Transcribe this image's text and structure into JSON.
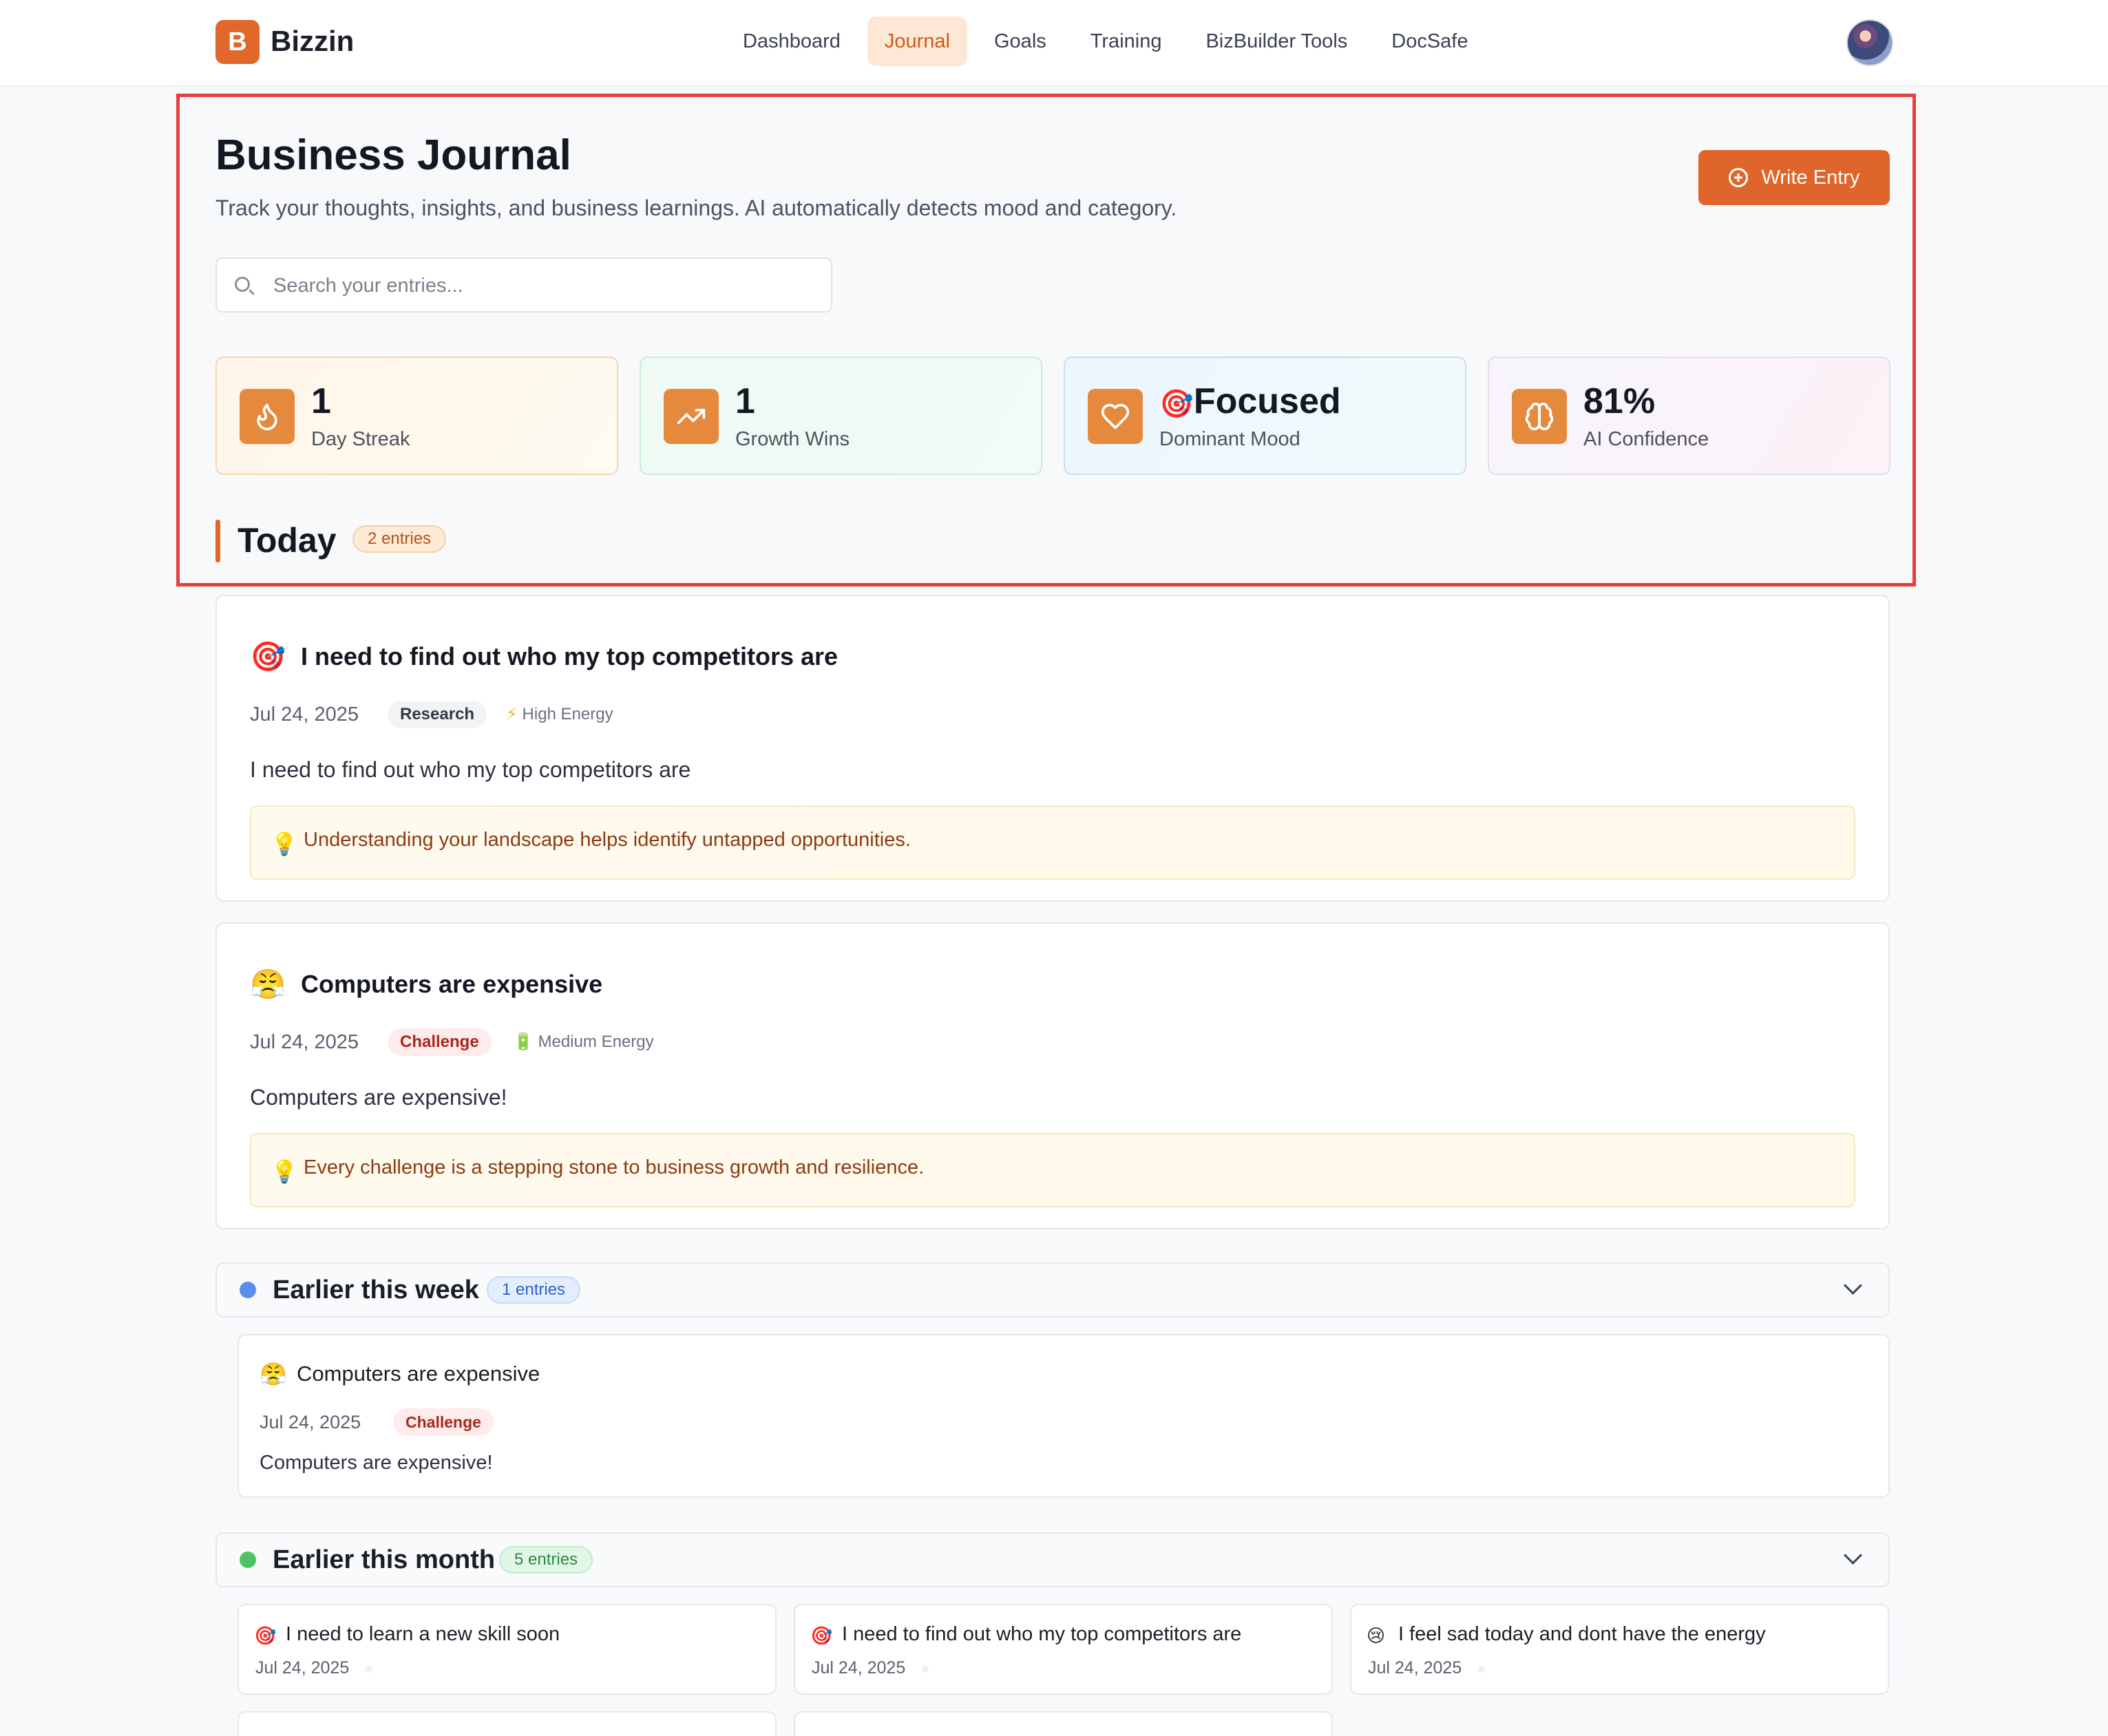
{
  "app": {
    "logo_letter": "B",
    "name": "Bizzin"
  },
  "nav": {
    "items": [
      {
        "label": "Dashboard",
        "active": false
      },
      {
        "label": "Journal",
        "active": true
      },
      {
        "label": "Goals",
        "active": false
      },
      {
        "label": "Training",
        "active": false
      },
      {
        "label": "BizBuilder Tools",
        "active": false
      },
      {
        "label": "DocSafe",
        "active": false
      }
    ]
  },
  "header": {
    "title": "Business Journal",
    "subtitle": "Track your thoughts, insights, and business learnings. AI automatically detects mood and category.",
    "write_button": "Write Entry"
  },
  "search": {
    "placeholder": "Search your entries..."
  },
  "stats": [
    {
      "value": "1",
      "label": "Day Streak",
      "icon": "flame-icon"
    },
    {
      "value": "1",
      "label": "Growth Wins",
      "icon": "trending-up-icon"
    },
    {
      "emoji": "🎯",
      "value": "Focused",
      "label": "Dominant Mood",
      "icon": "heart-icon"
    },
    {
      "value": "81%",
      "label": "AI Confidence",
      "icon": "brain-icon"
    }
  ],
  "today": {
    "title": "Today",
    "count": "2 entries",
    "entries": [
      {
        "emoji": "🎯",
        "title": "I need to find out who my top competitors are",
        "date": "Jul 24, 2025",
        "category": "Research",
        "energy_icon": "⚡",
        "energy": "High Energy",
        "body": "I need to find out who my top competitors are",
        "insight_icon": "💡",
        "insight": "Understanding your landscape helps identify untapped opportunities."
      },
      {
        "emoji": "😤",
        "title": "Computers are expensive",
        "date": "Jul 24, 2025",
        "category": "Challenge",
        "energy_icon": "🔋",
        "energy": "Medium Energy",
        "body": "Computers are expensive!",
        "insight_icon": "💡",
        "insight": "Every challenge is a stepping stone to business growth and resilience."
      }
    ]
  },
  "week": {
    "title": "Earlier this week",
    "count": "1 entries",
    "entries": [
      {
        "emoji": "😤",
        "title": "Computers are expensive",
        "date": "Jul 24, 2025",
        "category": "Challenge",
        "body": "Computers are expensive!"
      }
    ]
  },
  "month": {
    "title": "Earlier this month",
    "count": "5 entries",
    "entries": [
      {
        "emoji": "🎯",
        "title": "I need to learn a new skill soon",
        "date": "Jul 24, 2025"
      },
      {
        "emoji": "🎯",
        "title": "I need to find out who my top competitors are",
        "date": "Jul 24, 2025"
      },
      {
        "emoji": "😢",
        "title": "I feel sad today and dont have the energy",
        "date": "Jul 24, 2025"
      }
    ]
  },
  "colors": {
    "accent": "#e2672a",
    "highlight_border": "#e2413e",
    "week_dot": "#5b8def",
    "month_dot": "#4cc464"
  }
}
